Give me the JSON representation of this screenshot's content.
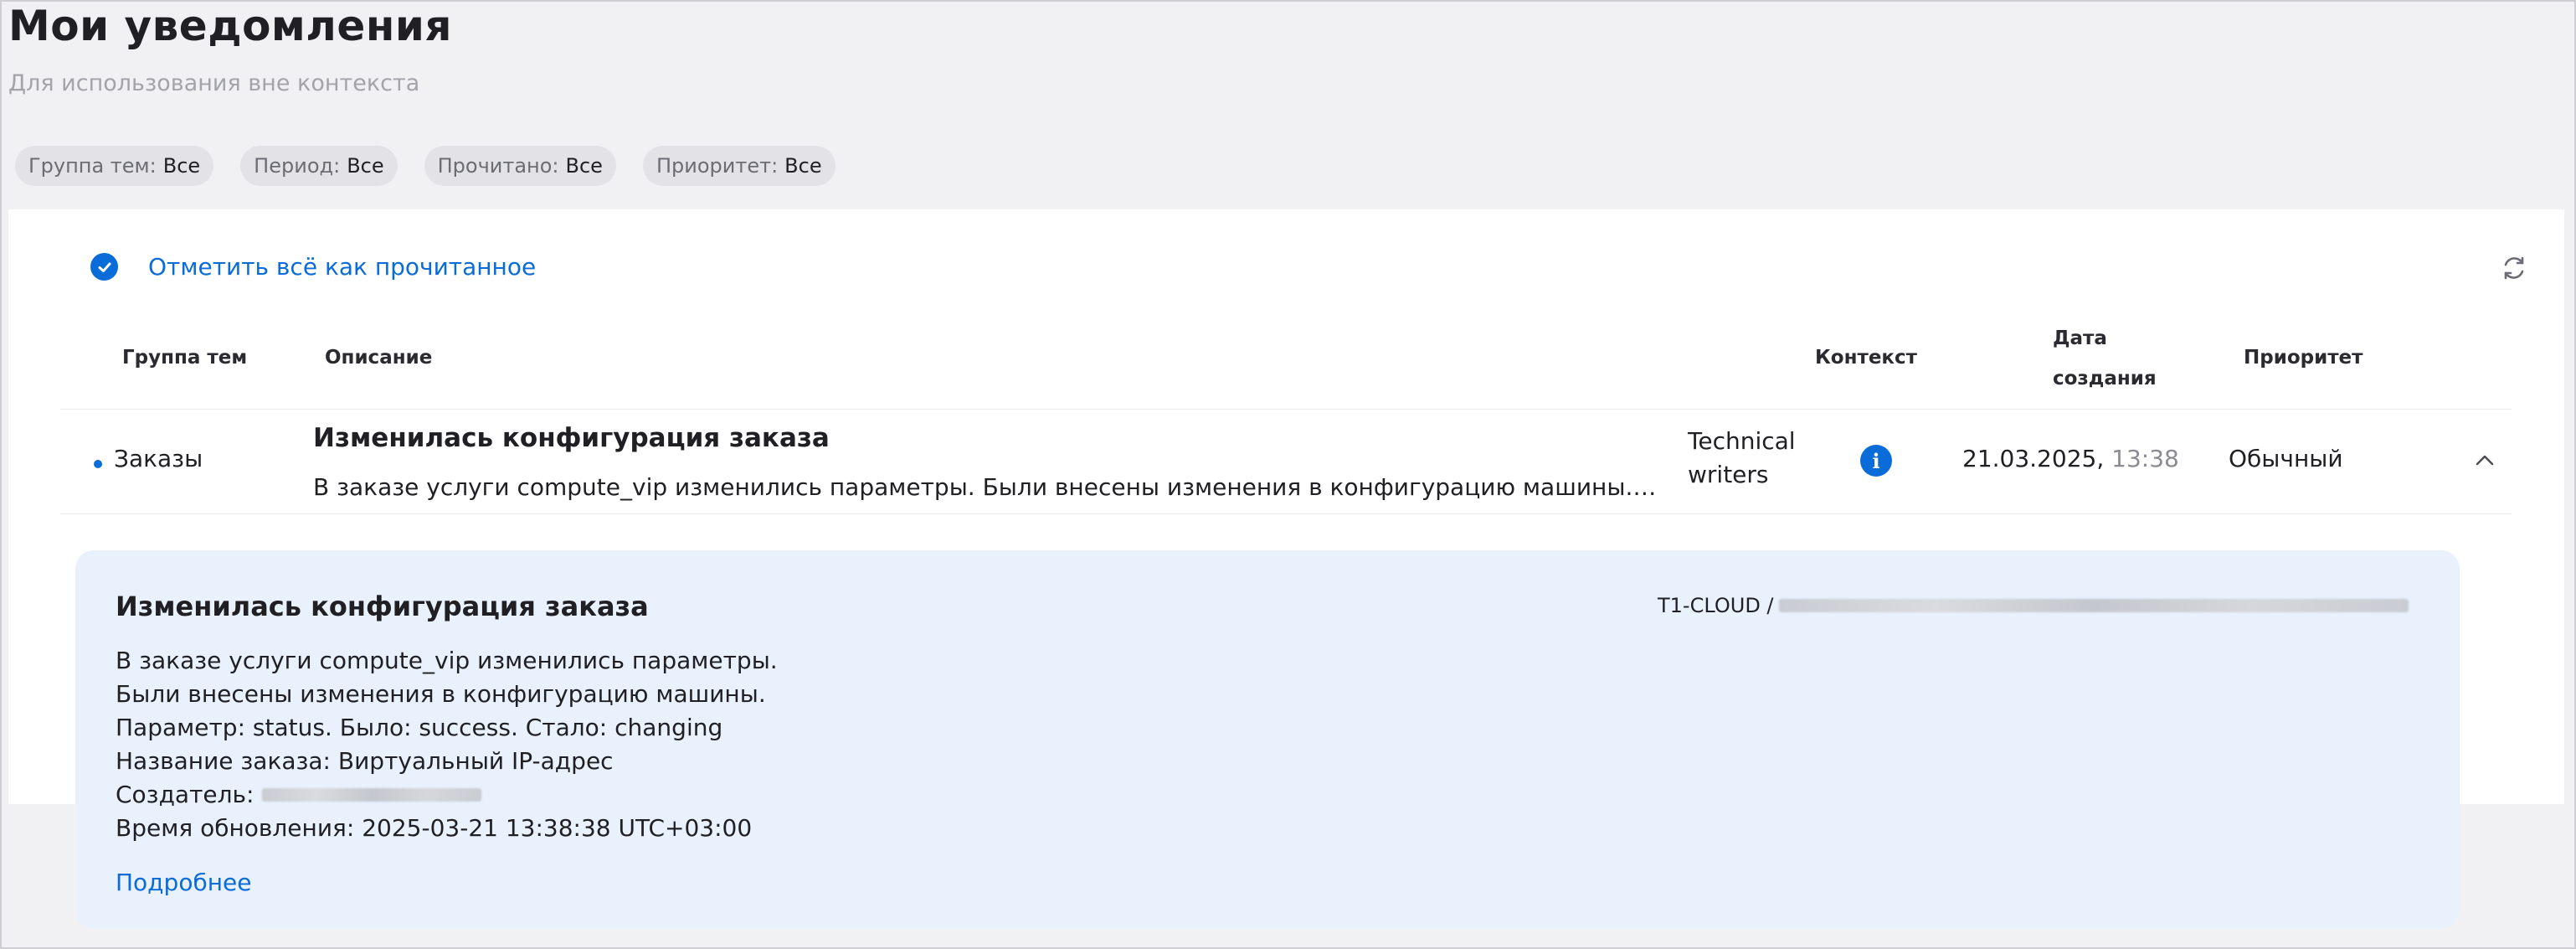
{
  "header": {
    "title": "Мои уведомления",
    "subtitle": "Для использования вне контекста"
  },
  "filters": [
    {
      "label": "Группа тем:",
      "value": "Все"
    },
    {
      "label": "Период:",
      "value": "Все"
    },
    {
      "label": "Прочитано:",
      "value": "Все"
    },
    {
      "label": "Приоритет:",
      "value": "Все"
    }
  ],
  "toolbar": {
    "mark_all_label": "Отметить всё как прочитанное",
    "refresh_icon": "refresh-icon"
  },
  "table": {
    "columns": {
      "group": "Группа тем",
      "description": "Описание",
      "context": "Контекст",
      "date_line1": "Дата",
      "date_line2": "создания",
      "priority": "Приоритет"
    },
    "rows": [
      {
        "unread": true,
        "group": "Заказы",
        "title": "Изменилась конфигурация заказа",
        "text": "В заказе услуги compute_vip изменились параметры. Были внесены изменения в конфигурацию машины.…",
        "context_line1": "Technical",
        "context_line2": "writers",
        "date": "21.03.2025,",
        "time": "13:38",
        "priority": "Обычный",
        "expanded": true
      }
    ]
  },
  "detail": {
    "title": "Изменилась конфигурация заказа",
    "path_prefix": "T1-CLOUD /",
    "lines": [
      "В заказе услуги compute_vip изменились параметры.",
      "Были внесены изменения в конфигурацию машины.",
      "Параметр: status. Было: success. Стало: changing",
      "Название заказа: Виртуальный IP-адрес",
      "Создатель:",
      "Время обновления: 2025-03-21 13:38:38 UTC+03:00"
    ],
    "more_link": "Подробнее"
  },
  "colors": {
    "accent": "#0a6cd9",
    "detail_bg": "#e8f1fc",
    "page_bg": "#f1f1f3"
  }
}
